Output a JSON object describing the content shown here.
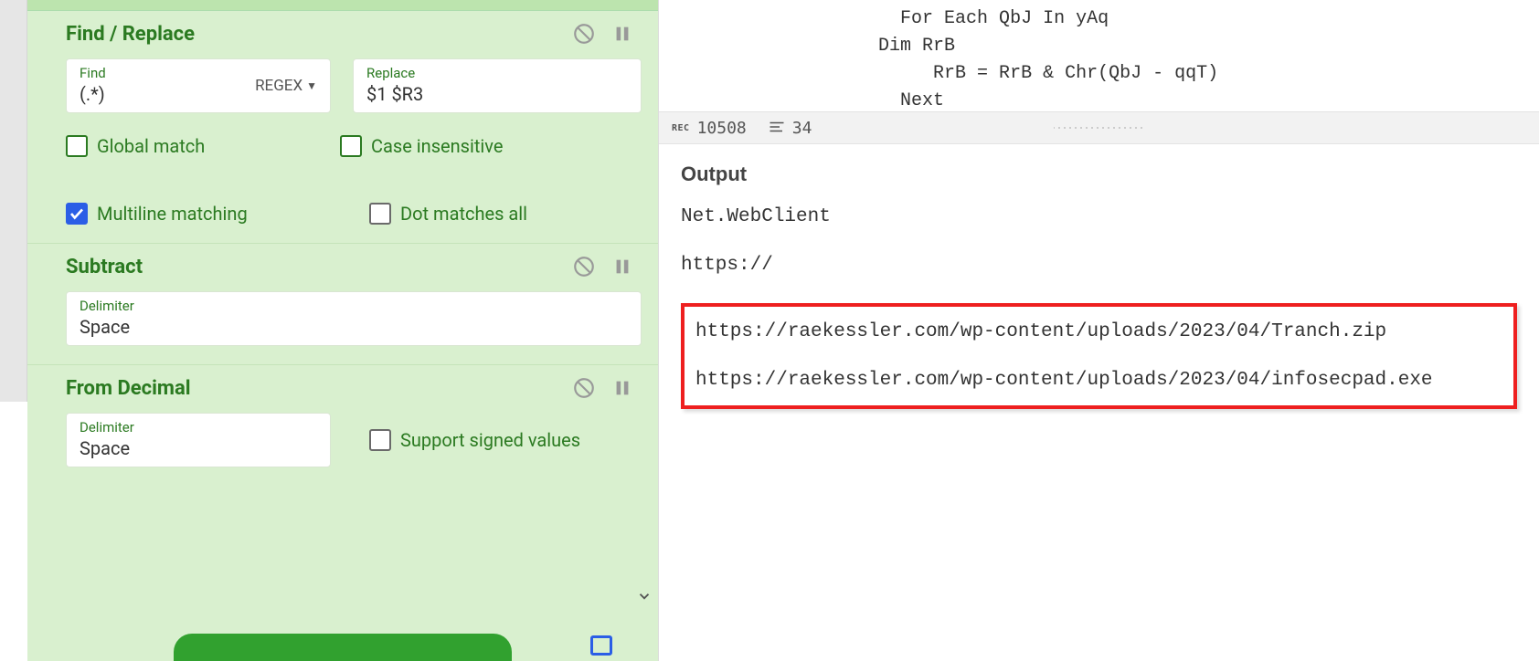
{
  "operations": {
    "findReplace": {
      "title": "Find / Replace",
      "findLabel": "Find",
      "findValue": "(.*)",
      "regexBadge": "REGEX",
      "replaceLabel": "Replace",
      "replaceValue": "$1 $R3",
      "options": {
        "global": {
          "label": "Global match",
          "checked": false
        },
        "caseInsensitive": {
          "label": "Case insensitive",
          "checked": false
        },
        "multiline": {
          "label": "Multiline matching",
          "checked": true
        },
        "dotAll": {
          "label": "Dot matches all",
          "checked": false
        }
      }
    },
    "subtract": {
      "title": "Subtract",
      "delimiterLabel": "Delimiter",
      "delimiterValue": "Space"
    },
    "fromDecimal": {
      "title": "From Decimal",
      "delimiterLabel": "Delimiter",
      "delimiterValue": "Space",
      "signed": {
        "label": "Support signed values",
        "checked": false
      }
    }
  },
  "code": {
    "line1": "                      For Each QbJ In yAq",
    "line2": "                    Dim RrB",
    "line3": "                         RrB = RrB & Chr(QbJ - qqT)",
    "line4": "                      Next"
  },
  "status": {
    "recLabel": "REC",
    "recValue": "10508",
    "linesValue": "34"
  },
  "output": {
    "title": "Output",
    "line1": "Net.WebClient",
    "line2": "https://",
    "highlighted1": "https://raekessler.com/wp-content/uploads/2023/04/Tranch.zip",
    "highlighted2": "https://raekessler.com/wp-content/uploads/2023/04/infosecpad.exe"
  }
}
